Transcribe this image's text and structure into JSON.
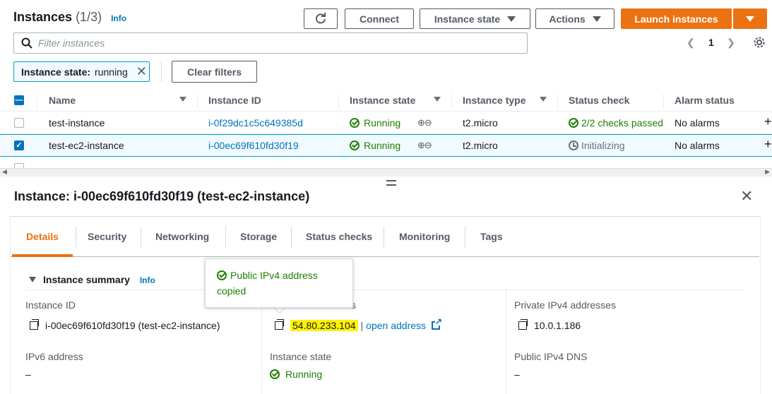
{
  "header": {
    "title": "Instances",
    "count": "(1/3)",
    "info": "Info",
    "refresh_icon": "refresh-icon",
    "connect": "Connect",
    "instance_state": "Instance state",
    "actions": "Actions",
    "launch": "Launch instances",
    "accent_color": "#ec7211"
  },
  "search": {
    "placeholder": "Filter instances"
  },
  "pagination": {
    "page": "1"
  },
  "filter": {
    "key": "Instance state:",
    "value": "running",
    "clear": "Clear filters"
  },
  "table": {
    "columns": [
      "Name",
      "Instance ID",
      "Instance state",
      "Instance type",
      "Status check",
      "Alarm status"
    ],
    "rows": [
      {
        "name": "test-instance",
        "id": "i-0f29dc1c5c649385d",
        "state": "Running",
        "type": "t2.micro",
        "status": "2/2 checks passed",
        "alarm": "No alarms",
        "selected": false
      },
      {
        "name": "test-ec2-instance",
        "id": "i-00ec69f610fd30f19",
        "state": "Running",
        "type": "t2.micro",
        "status": "Initializing",
        "alarm": "No alarms",
        "selected": true
      }
    ]
  },
  "detail": {
    "title": "Instance: i-00ec69f610fd30f19 (test-ec2-instance)",
    "tabs": [
      "Details",
      "Security",
      "Networking",
      "Storage",
      "Status checks",
      "Monitoring",
      "Tags"
    ],
    "section": "Instance summary",
    "info": "Info",
    "instance_id_label": "Instance ID",
    "instance_id_value": "i-00ec69f610fd30f19 (test-ec2-instance)",
    "public_ip_label_tail": "s",
    "public_ip_value": "54.80.233.104",
    "open_address": "open address",
    "private_ip_label": "Private IPv4 addresses",
    "private_ip_value": "10.0.1.186",
    "ipv6_label": "IPv6 address",
    "ipv6_value": "–",
    "state_label": "Instance state",
    "state_value": "Running",
    "public_dns_label": "Public IPv4 DNS",
    "public_dns_value": "–"
  },
  "tooltip": {
    "line1": "Public IPv4 address",
    "line2": "copied"
  }
}
